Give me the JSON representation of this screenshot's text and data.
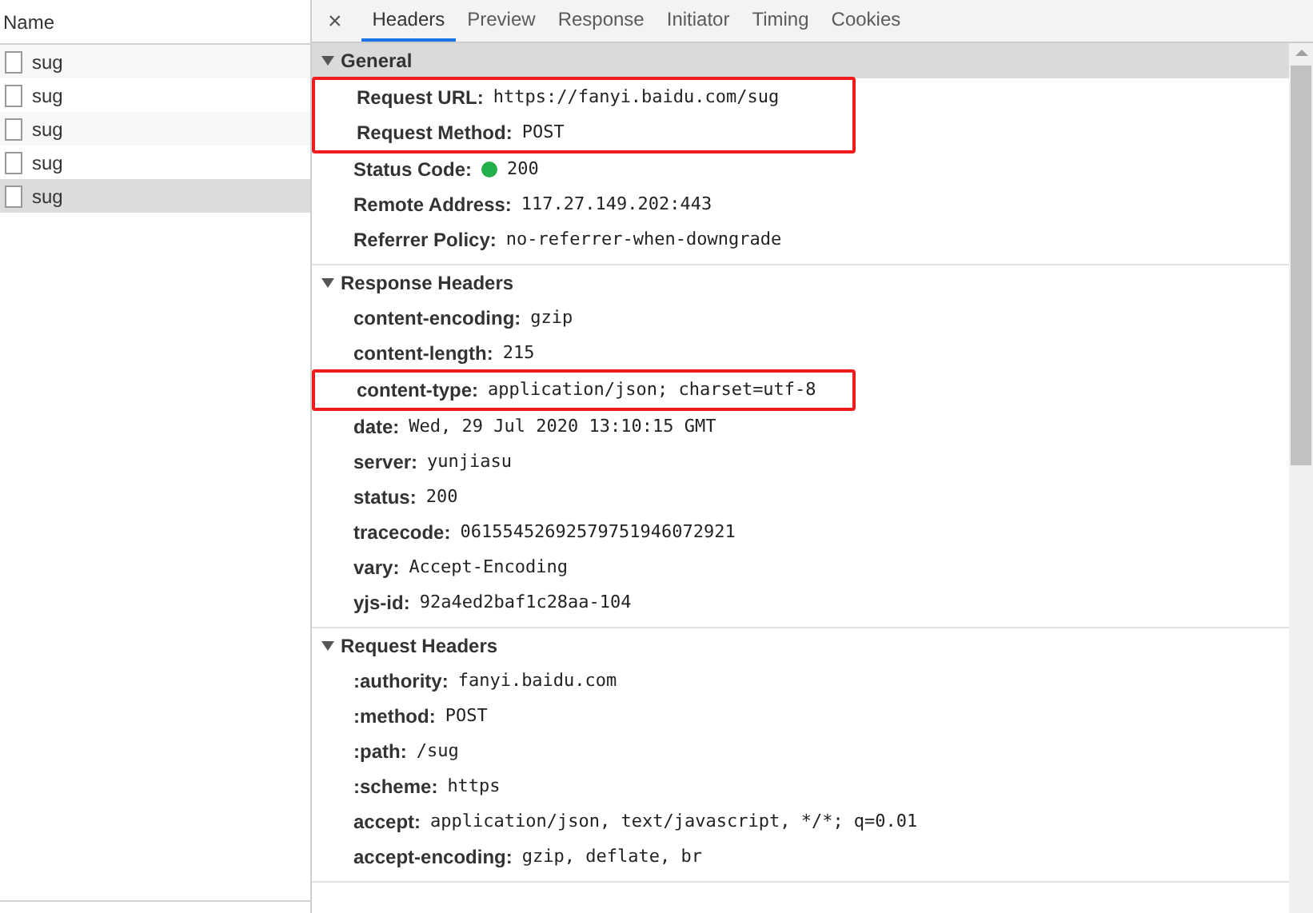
{
  "requests": {
    "column": "Name",
    "rows": [
      {
        "name": "sug",
        "selected": false
      },
      {
        "name": "sug",
        "selected": false
      },
      {
        "name": "sug",
        "selected": false
      },
      {
        "name": "sug",
        "selected": false
      },
      {
        "name": "sug",
        "selected": true
      }
    ]
  },
  "close": "×",
  "tabs": [
    {
      "label": "Headers",
      "selected": true
    },
    {
      "label": "Preview",
      "selected": false
    },
    {
      "label": "Response",
      "selected": false
    },
    {
      "label": "Initiator",
      "selected": false
    },
    {
      "label": "Timing",
      "selected": false
    },
    {
      "label": "Cookies",
      "selected": false
    }
  ],
  "sections": [
    {
      "title": "General",
      "expanded": true,
      "focused": true,
      "items": [
        {
          "key": "Request URL:",
          "value": "https://fanyi.baidu.com/sug",
          "highlighted": true
        },
        {
          "key": "Request Method:",
          "value": "POST",
          "highlighted": true
        },
        {
          "key": "Status Code:",
          "value": "200",
          "highlighted": false,
          "color": "#22b14c"
        },
        {
          "key": "Remote Address:",
          "value": "117.27.149.202:443",
          "highlighted": false
        },
        {
          "key": "Referrer Policy:",
          "value": "no-referrer-when-downgrade",
          "highlighted": false
        }
      ]
    },
    {
      "title": "Response Headers",
      "expanded": true,
      "focused": false,
      "items": [
        {
          "key": "content-encoding:",
          "value": "gzip",
          "highlighted": false
        },
        {
          "key": "content-length:",
          "value": "215",
          "highlighted": false
        },
        {
          "key": "content-type:",
          "value": "application/json; charset=utf-8",
          "highlighted": true
        },
        {
          "key": "date:",
          "value": "Wed, 29 Jul 2020 13:10:15 GMT",
          "highlighted": false
        },
        {
          "key": "server:",
          "value": "yunjiasu",
          "highlighted": false
        },
        {
          "key": "status:",
          "value": "200",
          "highlighted": false
        },
        {
          "key": "tracecode:",
          "value": "06155452692579751946072921",
          "highlighted": false
        },
        {
          "key": "vary:",
          "value": "Accept-Encoding",
          "highlighted": false
        },
        {
          "key": "yjs-id:",
          "value": "92a4ed2baf1c28aa-104",
          "highlighted": false
        }
      ]
    },
    {
      "title": "Request Headers",
      "expanded": true,
      "focused": false,
      "items": [
        {
          "key": ":authority:",
          "value": "fanyi.baidu.com",
          "highlighted": false
        },
        {
          "key": ":method:",
          "value": "POST",
          "highlighted": false
        },
        {
          "key": ":path:",
          "value": "/sug",
          "highlighted": false
        },
        {
          "key": ":scheme:",
          "value": "https",
          "highlighted": false
        },
        {
          "key": "accept:",
          "value": "application/json, text/javascript, */*; q=0.01",
          "highlighted": false
        },
        {
          "key": "accept-encoding:",
          "value": "gzip, deflate, br",
          "highlighted": false
        }
      ]
    }
  ]
}
